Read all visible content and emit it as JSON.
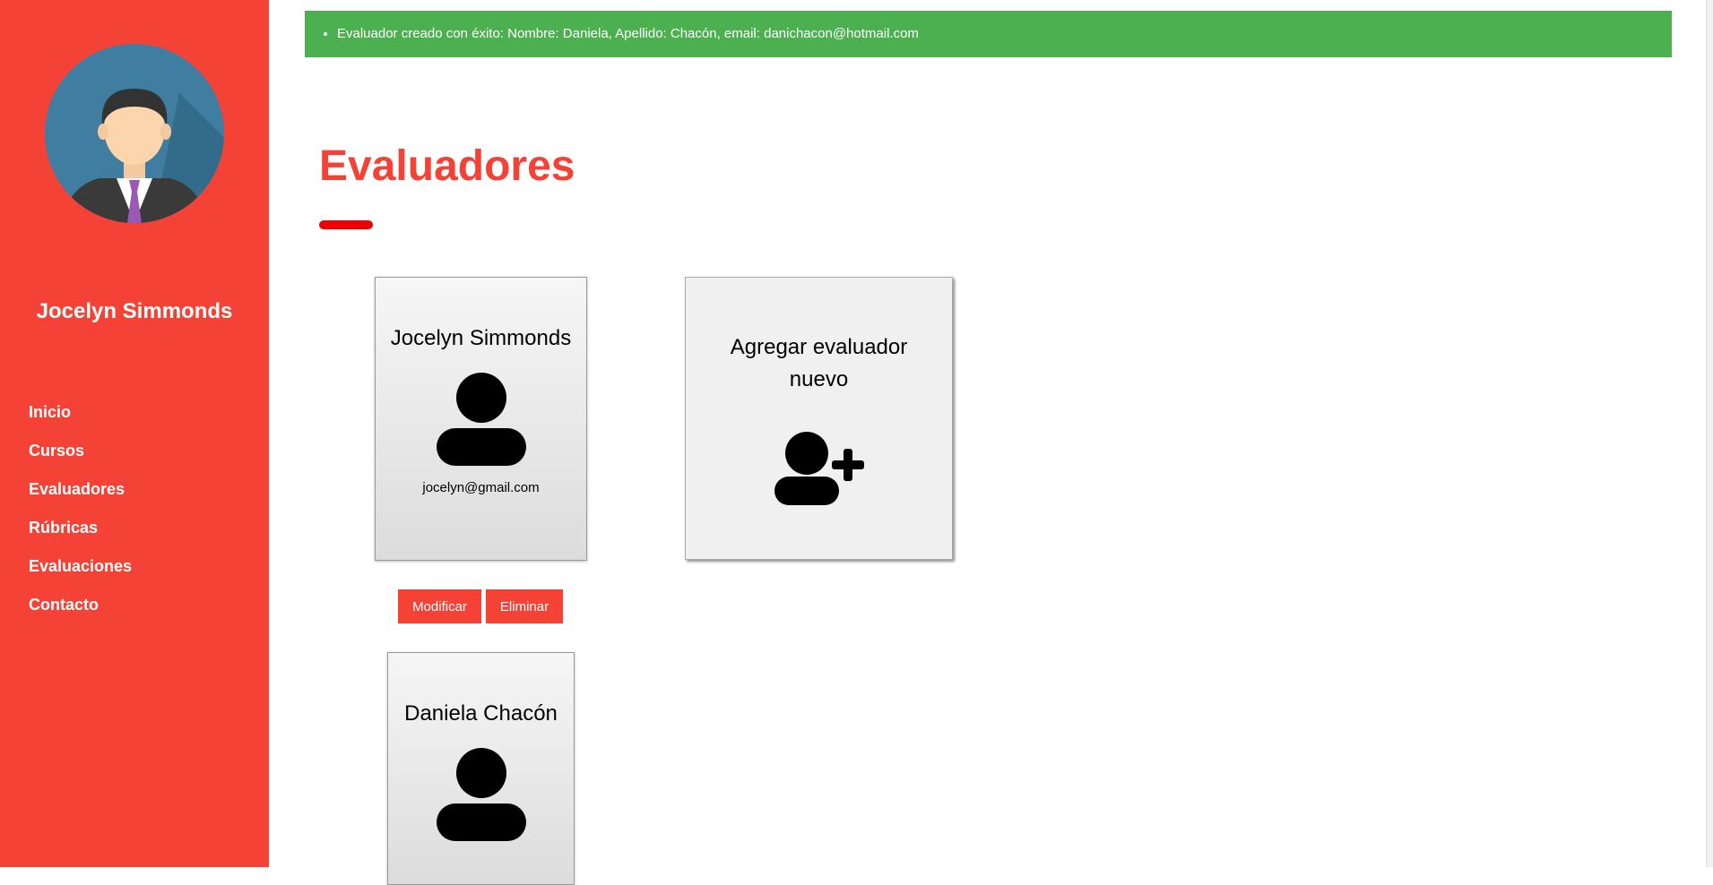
{
  "sidebar": {
    "user_name": "Jocelyn Simmonds",
    "nav": [
      "Inicio",
      "Cursos",
      "Evaluadores",
      "Rúbricas",
      "Evaluaciones",
      "Contacto"
    ]
  },
  "alert": {
    "message": "Evaluador creado con éxito: Nombre: Daniela, Apellido: Chacón, email: danichacon@hotmail.com"
  },
  "main": {
    "title": "Evaluadores",
    "evaluators": [
      {
        "name": "Jocelyn Simmonds",
        "email": "jocelyn@gmail.com"
      },
      {
        "name": "Daniela Chacón",
        "email": ""
      }
    ],
    "add_card_label": "Agregar evaluador nuevo",
    "modify_label": "Modificar",
    "delete_label": "Eliminar"
  },
  "colors": {
    "accent": "#f44336",
    "success": "#4caf50",
    "underline": "#ee0000"
  },
  "icons": [
    "user-avatar-icon",
    "person-icon",
    "add-user-icon"
  ]
}
